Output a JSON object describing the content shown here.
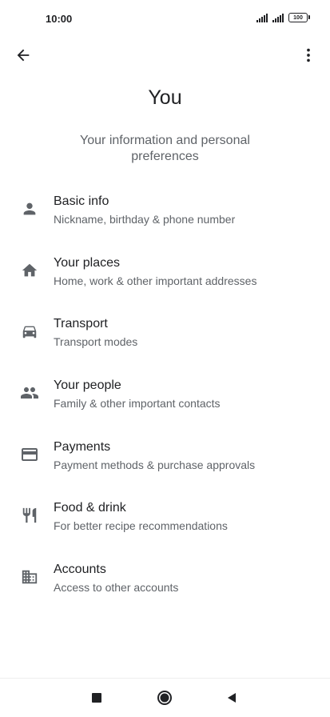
{
  "status_bar": {
    "time": "10:00",
    "battery": "100"
  },
  "app_bar": {
    "back_icon": "arrow-back-icon",
    "more_icon": "more-vert-icon"
  },
  "page": {
    "title": "You",
    "subtitle": "Your information and personal preferences"
  },
  "menu": {
    "items": [
      {
        "icon": "person-icon",
        "title": "Basic info",
        "description": "Nickname, birthday & phone number"
      },
      {
        "icon": "home-icon",
        "title": "Your places",
        "description": "Home, work & other important addresses"
      },
      {
        "icon": "car-icon",
        "title": "Transport",
        "description": "Transport modes"
      },
      {
        "icon": "people-icon",
        "title": "Your people",
        "description": "Family & other important contacts"
      },
      {
        "icon": "credit-card-icon",
        "title": "Payments",
        "description": "Payment methods & purchase approvals"
      },
      {
        "icon": "restaurant-icon",
        "title": "Food & drink",
        "description": "For better recipe recommendations"
      },
      {
        "icon": "building-icon",
        "title": "Accounts",
        "description": "Access to other accounts"
      }
    ]
  },
  "nav_bar": {
    "recents_icon": "square-icon",
    "home_icon": "circle-icon",
    "back_icon": "triangle-back-icon"
  },
  "colors": {
    "text_primary": "#202124",
    "text_secondary": "#5f6368",
    "icon": "#5f6368",
    "background": "#ffffff"
  }
}
